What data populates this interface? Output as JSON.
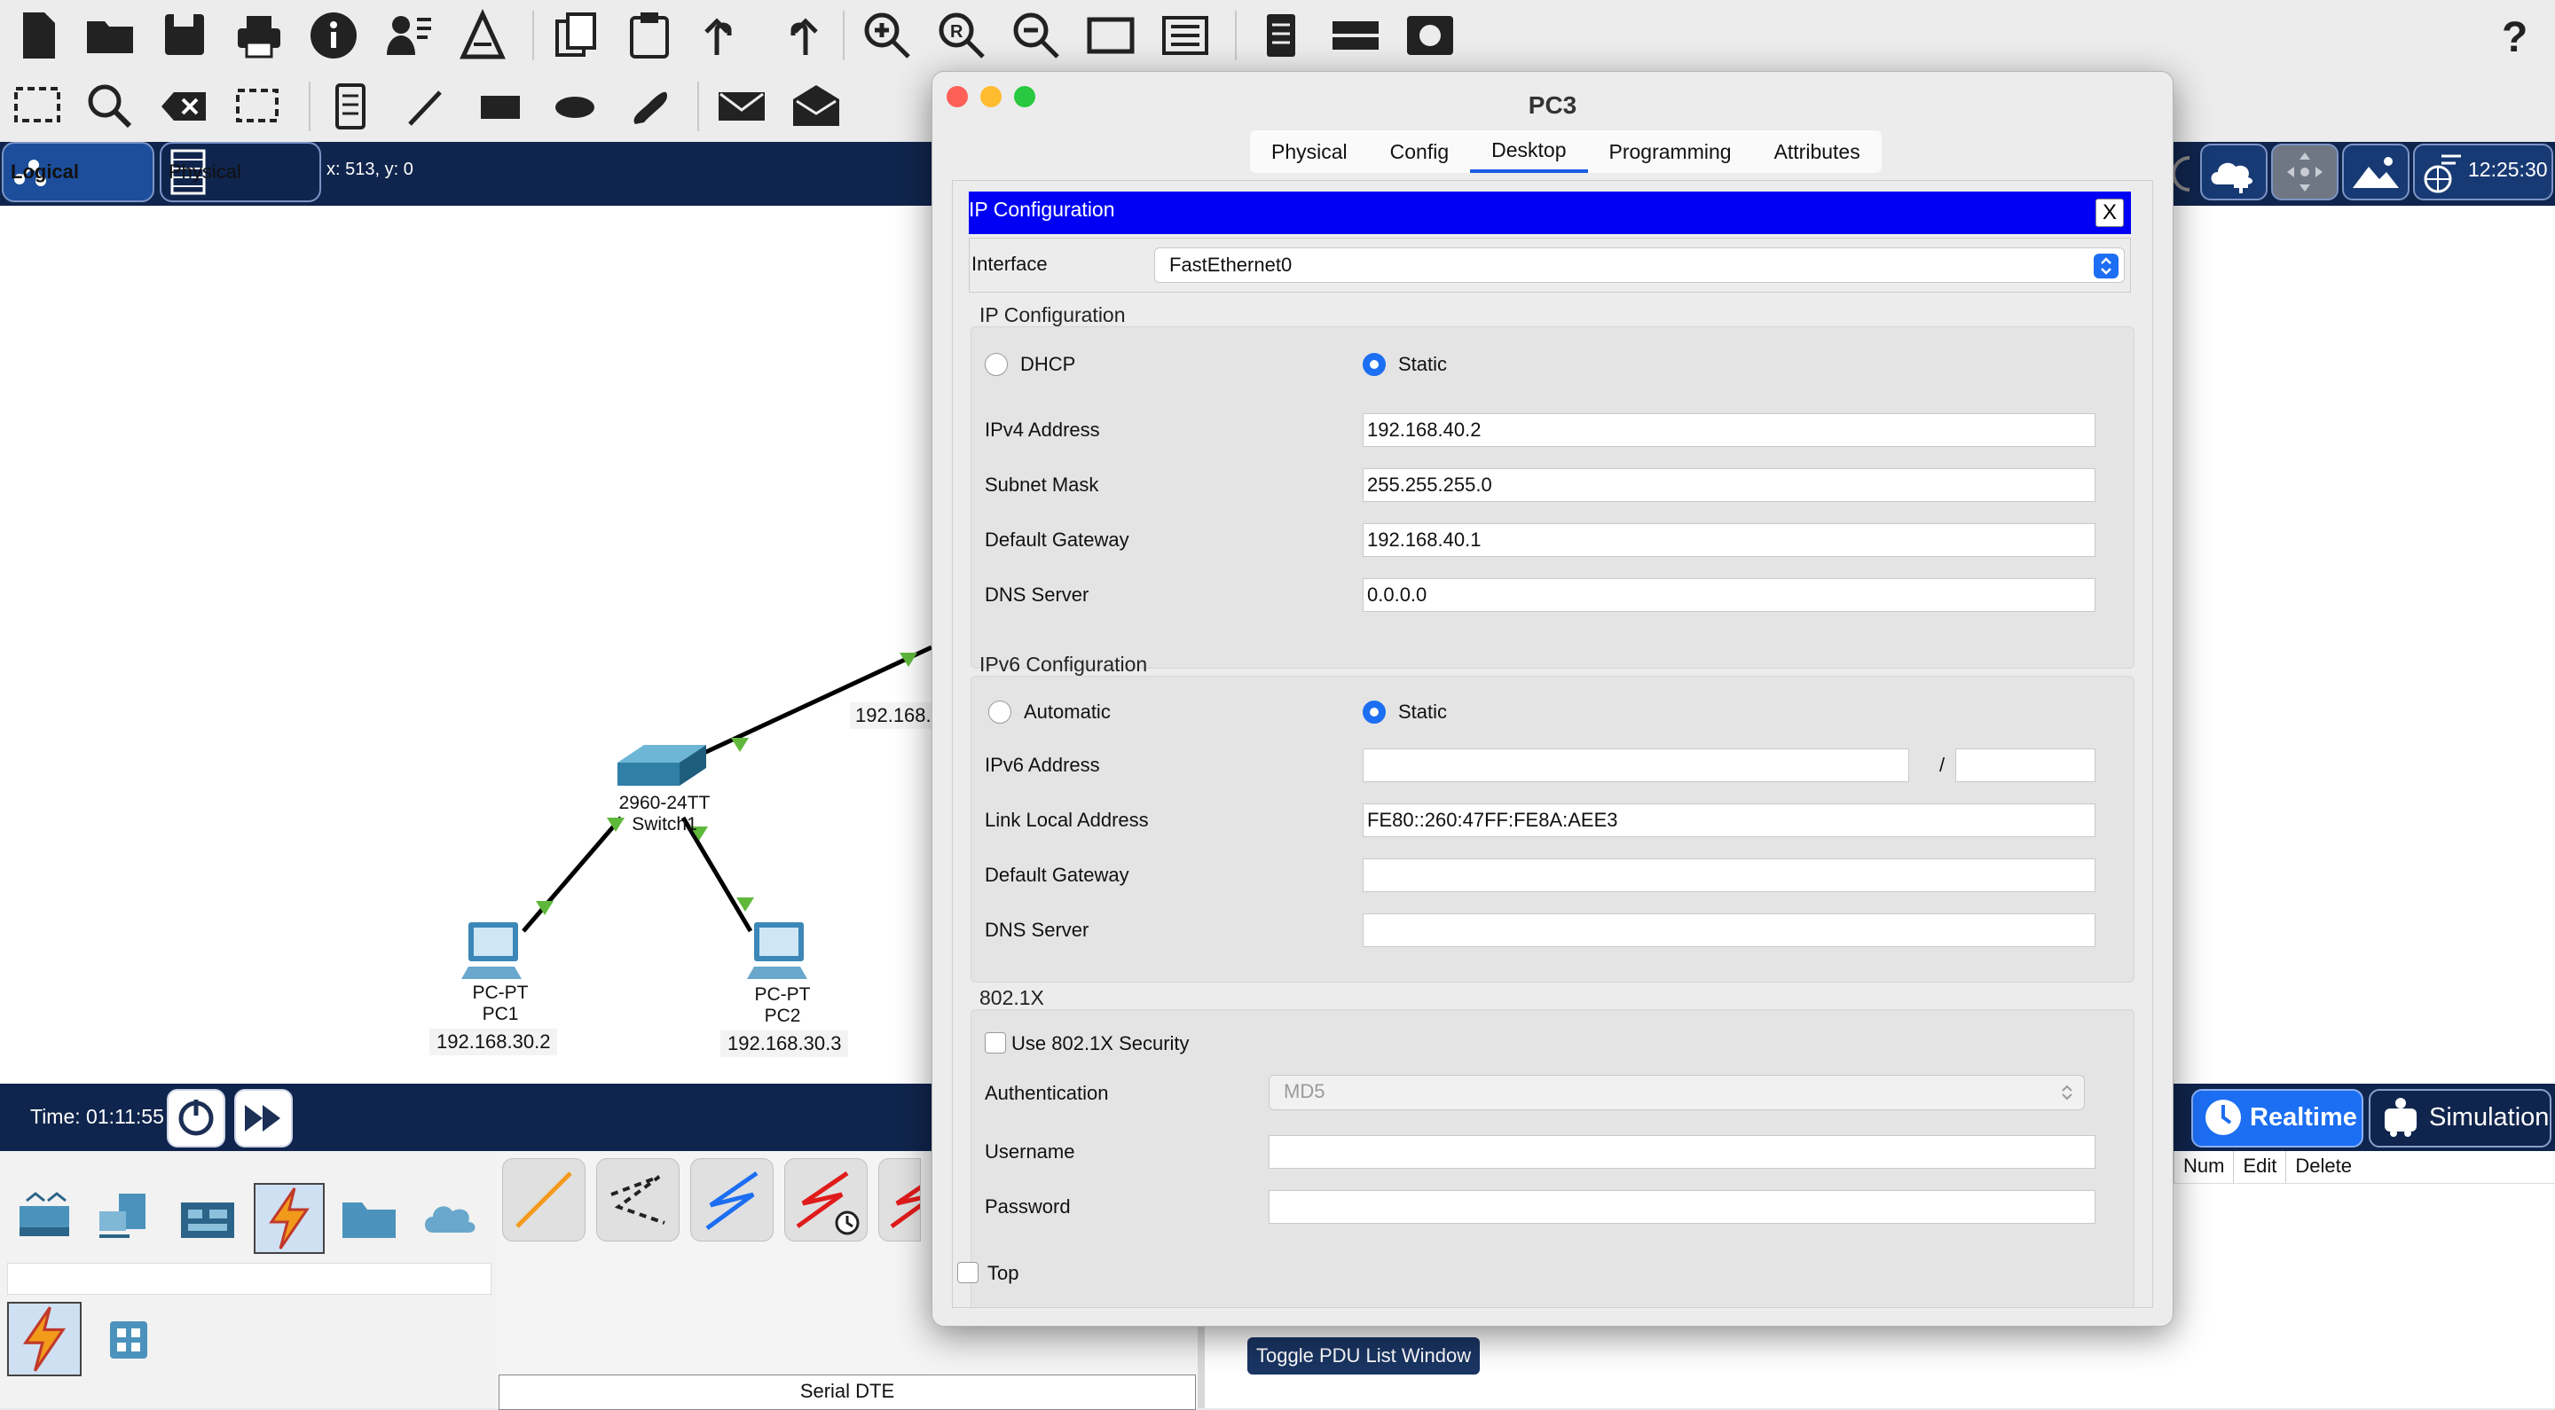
{
  "mode": {
    "logical": "Logical",
    "physical": "Physical",
    "coords": "x: 513, y: 0",
    "clock": "12:25:30"
  },
  "time_bar": {
    "time": "Time: 01:11:55",
    "realtime": "Realtime",
    "simulation": "Simulation"
  },
  "topology": {
    "switch_model": "2960-24TT",
    "switch_name": "Switch1",
    "pc1_model": "PC-PT",
    "pc1_name": "PC1",
    "pc1_ip": "192.168.30.2",
    "pc2_model": "PC-PT",
    "pc2_name": "PC2",
    "pc2_ip": "192.168.30.3",
    "partial_ip": "192.168."
  },
  "bottom": {
    "cable_label": "Serial DTE",
    "pdu_cols": [
      "Num",
      "Edit",
      "Delete"
    ],
    "toggle_pdu": "Toggle PDU List Window"
  },
  "dialog": {
    "title": "PC3",
    "tabs": [
      "Physical",
      "Config",
      "Desktop",
      "Programming",
      "Attributes"
    ],
    "active_tab": "Desktop",
    "ip_config_title": "IP Configuration",
    "close": "X",
    "interface_label": "Interface",
    "interface_value": "FastEthernet0",
    "ipv4_section": "IP Configuration",
    "dhcp": "DHCP",
    "static": "Static",
    "ipv4_label": "IPv4 Address",
    "ipv4_value": "192.168.40.2",
    "mask_label": "Subnet Mask",
    "mask_value": "255.255.255.0",
    "gw_label": "Default Gateway",
    "gw_value": "192.168.40.1",
    "dns_label": "DNS Server",
    "dns_value": "0.0.0.0",
    "ipv6_section": "IPv6 Configuration",
    "automatic": "Automatic",
    "static6": "Static",
    "ipv6_label": "IPv6 Address",
    "ipv6_value": "",
    "prefix_sep": "/",
    "prefix_value": "",
    "lla_label": "Link Local Address",
    "lla_value": "FE80::260:47FF:FE8A:AEE3",
    "gw6_label": "Default Gateway",
    "gw6_value": "",
    "dns6_label": "DNS Server",
    "dns6_value": "",
    "dot1x_section": "802.1X",
    "use_8021x": "Use 802.1X Security",
    "auth_label": "Authentication",
    "auth_value": "MD5",
    "user_label": "Username",
    "user_value": "",
    "pass_label": "Password",
    "pass_value": "",
    "top_label": "Top"
  },
  "colors": {
    "accent": "#1c6ef2",
    "ip_bar": "#0000f5",
    "navy": "#10254d",
    "link_green": "#5fb83b"
  }
}
